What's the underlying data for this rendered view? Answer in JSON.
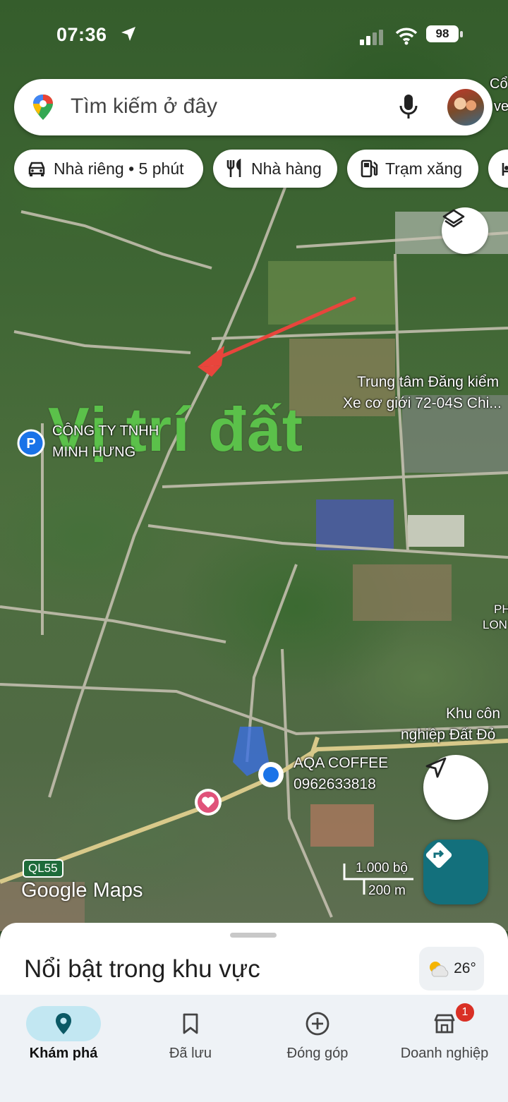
{
  "status_bar": {
    "time": "07:36",
    "battery": "98"
  },
  "search": {
    "placeholder": "Tìm kiếm ở đây"
  },
  "chips": [
    {
      "label": "Nhà riêng • 5 phút",
      "icon": "car-icon"
    },
    {
      "label": "Nhà hàng",
      "icon": "fork-knife-icon"
    },
    {
      "label": "Trạm xăng",
      "icon": "gas-station-icon"
    }
  ],
  "map": {
    "overlay_text": "Vị trí đất",
    "labels": {
      "company_line1": "CÔNG TY TNHH",
      "company_line2": "MINH HƯNG",
      "inspection_line1": "Trung tâm Đăng kiểm",
      "inspection_line2": "Xe cơ giới 72-04S Chi...",
      "top_right_1": "Cổ",
      "top_right_2": "ve",
      "ph_1": "PH",
      "ph_2": "LON",
      "park_line1": "Khu côn",
      "park_line2": "nghiệp Đất Đỏ",
      "coffee_name": "AQA COFFEE",
      "coffee_phone": "0962633818"
    },
    "road_shield": "QL55",
    "attribution": "Google Maps",
    "scale_top": "1.000 bộ",
    "scale_bottom": "200 m",
    "colors": {
      "arrow": "#e8453c",
      "overlay_text": "#5bc14a",
      "location_dot": "#1a73e8"
    }
  },
  "sheet": {
    "title": "Nổi bật trong khu vực",
    "temperature": "26°"
  },
  "nav": [
    {
      "label": "Khám phá",
      "icon": "explore-pin-icon",
      "active": true
    },
    {
      "label": "Đã lưu",
      "icon": "bookmark-icon",
      "active": false
    },
    {
      "label": "Đóng góp",
      "icon": "add-circle-icon",
      "active": false
    },
    {
      "label": "Doanh nghiệp",
      "icon": "business-icon",
      "active": false,
      "badge": "1"
    }
  ]
}
